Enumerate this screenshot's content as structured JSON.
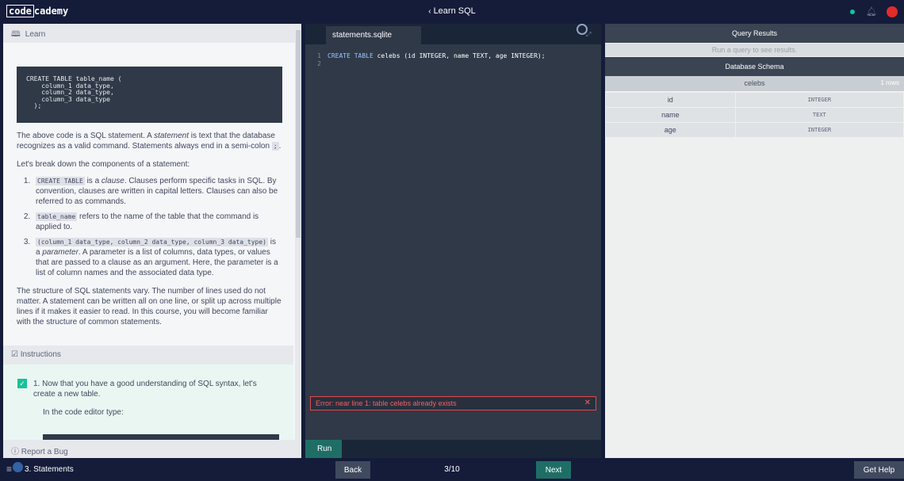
{
  "topbar": {
    "logo_box": "code",
    "logo_rest": "cademy",
    "course_back": "‹",
    "course_title": "Learn SQL"
  },
  "learn": {
    "header": "Learn",
    "code_block": "CREATE TABLE table_name (\n    column_1 data_type,\n    column_2 data_type,\n    column_3 data_type\n  );",
    "para1_pre": "The above code is a SQL statement. A ",
    "para1_em": "statement",
    "para1_post": " is text that the database recognizes as a valid command. Statements always end in a semi-colon ",
    "para1_code": ";",
    "para1_end": ".",
    "para2": "Let's break down the components of a statement:",
    "step1_code": "CREATE TABLE",
    "step1_pre": " is a ",
    "step1_em": "clause",
    "step1_post": ". Clauses perform specific tasks in SQL. By convention, clauses are written in capital letters. Clauses can also be referred to as commands.",
    "step2_code": "table_name",
    "step2_post": " refers to the name of the table that the command is applied to.",
    "step3_code": "(column_1 data_type, column_2 data_type, column_3 data_type)",
    "step3_pre": " is a ",
    "step3_em": "parameter",
    "step3_post": ". A parameter is a list of columns, data types, or values that are passed to a clause as an argument. Here, the parameter is a list of column names and the associated data type.",
    "para3": "The structure of SQL statements vary. The number of lines used do not matter. A statement can be written all on one line, or split up across multiple lines if it makes it easier to read. In this course, you will become familiar with the structure of common statements."
  },
  "instructions": {
    "header": "Instructions",
    "item1": "1. Now that you have a good understanding of SQL syntax, let's create a new table.",
    "item1_sub": "In the code editor type:"
  },
  "report_bug": "Report a Bug",
  "editor": {
    "tab": "statements.sqlite",
    "line_numbers": "1\n2",
    "code_kw1": "CREATE TABLE",
    "code_rest": " celebs (id INTEGER, name TEXT, age INTEGER);",
    "error": "Error: near line 1: table celebs already exists",
    "error_close": "✕",
    "run": "Run"
  },
  "results": {
    "query_header": "Query Results",
    "query_hint": "Run a query to see results.",
    "schema_header": "Database Schema",
    "table_name": "celebs",
    "table_rows": "1 rows",
    "columns": [
      {
        "name": "id",
        "type": "INTEGER"
      },
      {
        "name": "name",
        "type": "TEXT"
      },
      {
        "name": "age",
        "type": "INTEGER"
      }
    ]
  },
  "bottombar": {
    "lesson": "3. Statements",
    "back": "Back",
    "progress": "3/10",
    "next": "Next",
    "help": "Get Help"
  },
  "colors": {
    "nav_bg": "#141c3a",
    "accent_green": "#15c39a",
    "run_button": "#1f6e66",
    "error_red": "#f16162"
  }
}
